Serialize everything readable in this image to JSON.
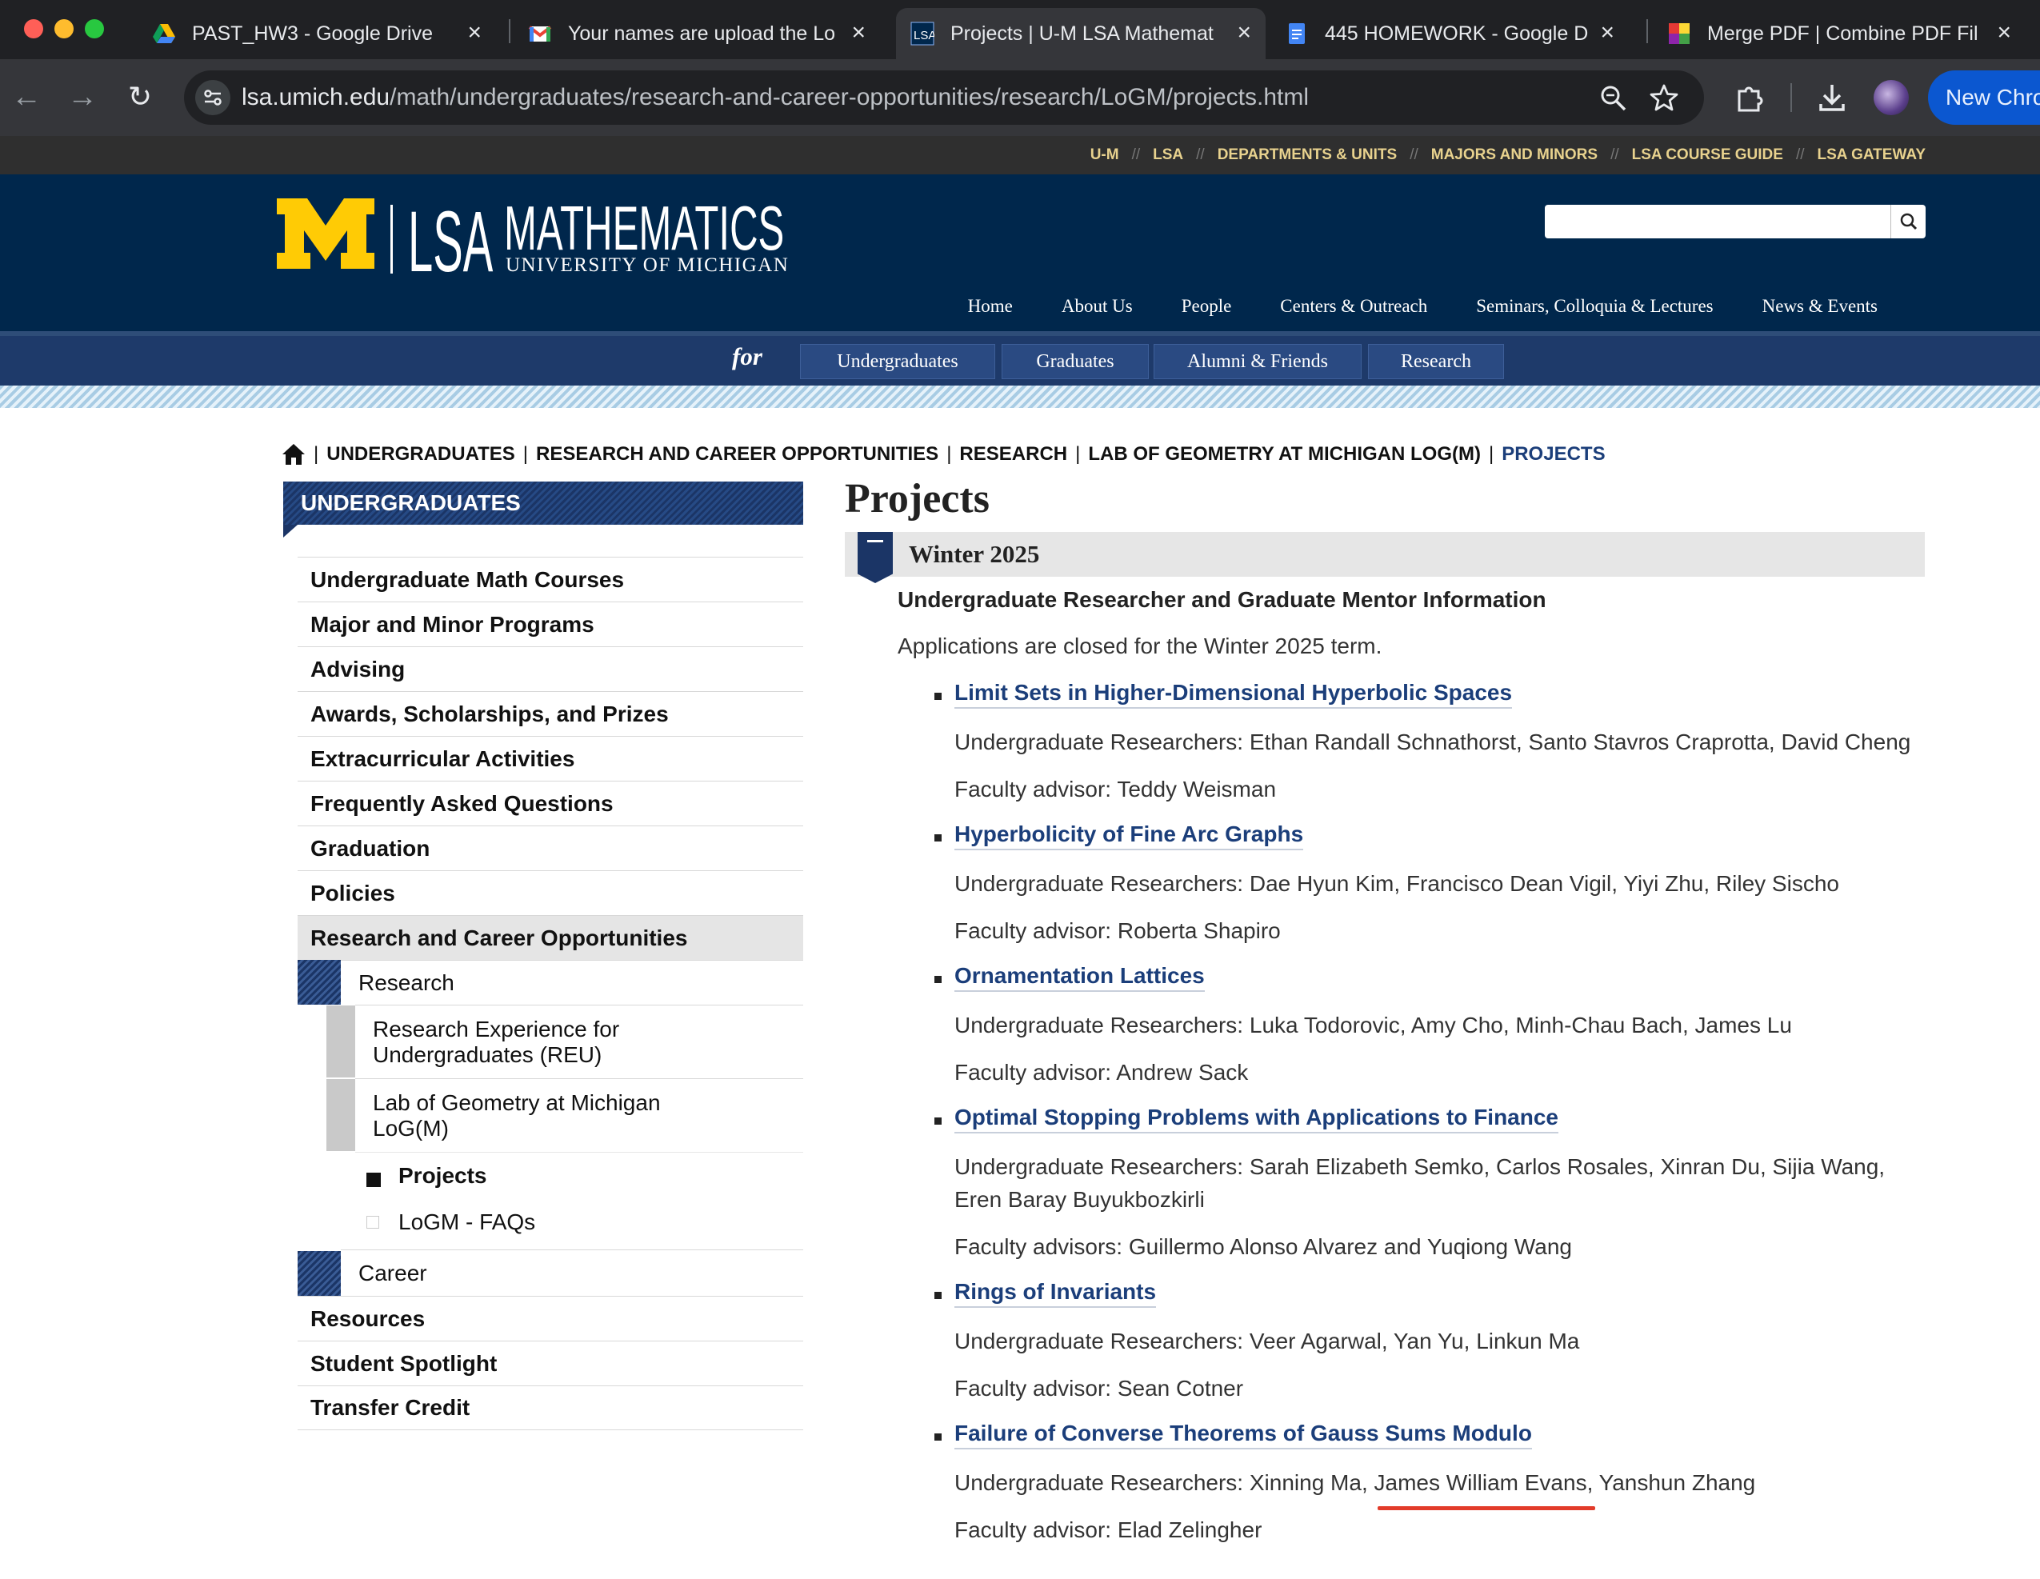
{
  "browser": {
    "tabs": [
      {
        "title": "PAST_HW3 - Google Drive",
        "icon": "google-drive-icon"
      },
      {
        "title": "Your names are upload the Lo",
        "icon": "gmail-icon"
      },
      {
        "title": "Projects | U-M LSA Mathemat",
        "icon": "lsa-favicon",
        "active": true
      },
      {
        "title": "445 HOMEWORK - Google Do",
        "icon": "google-docs-icon"
      },
      {
        "title": "Merge PDF | Combine PDF Fil",
        "icon": "ilovepdf-icon"
      }
    ],
    "url_host": "lsa.umich.edu",
    "url_path": "/math/undergraduates/research-and-career-opportunities/research/LoGM/projects.html",
    "new_chrome_label": "New Chro"
  },
  "utility_links": [
    "U-M",
    "LSA",
    "DEPARTMENTS & UNITS",
    "MAJORS AND MINORS",
    "LSA COURSE GUIDE",
    "LSA GATEWAY"
  ],
  "brand": {
    "lsa": "LSA",
    "department": "MATHEMATICS",
    "university": "UNIVERSITY OF MICHIGAN"
  },
  "main_nav": [
    "Home",
    "About Us",
    "People",
    "Centers & Outreach",
    "Seminars, Colloquia & Lectures",
    "News & Events"
  ],
  "audience": {
    "for_label": "for",
    "buttons": [
      "Undergraduates",
      "Graduates",
      "Alumni & Friends",
      "Research"
    ]
  },
  "breadcrumb": [
    "UNDERGRADUATES",
    "RESEARCH AND CAREER OPPORTUNITIES",
    "RESEARCH",
    "LAB OF GEOMETRY AT MICHIGAN LOG(M)",
    "PROJECTS"
  ],
  "sidebar": {
    "header": "UNDERGRADUATES",
    "items": [
      "Undergraduate Math Courses",
      "Major and Minor Programs",
      "Advising",
      "Awards, Scholarships, and Prizes",
      "Extracurricular Activities",
      "Frequently Asked Questions",
      "Graduation",
      "Policies",
      "Research and Career Opportunities"
    ],
    "research": "Research",
    "reu_line1": "Research Experience for",
    "reu_line2": "Undergraduates (REU)",
    "logm_line1": "Lab of Geometry at Michigan",
    "logm_line2": "LoG(M)",
    "projects": "Projects",
    "faqs": "LoGM - FAQs",
    "career": "Career",
    "after_items": [
      "Resources",
      "Student Spotlight",
      "Transfer Credit"
    ]
  },
  "content": {
    "page_title": "Projects",
    "term": "Winter 2025",
    "section_heading": "Undergraduate Researcher and Graduate Mentor Information",
    "intro": "Applications are closed for the Winter 2025 term.",
    "projects": [
      {
        "title": "Limit Sets in Higher-Dimensional Hyperbolic Spaces",
        "researchers": "Undergraduate Researchers: Ethan Randall Schnathorst, Santo Stavros Craprotta, David Cheng",
        "advisor": "Faculty advisor: Teddy Weisman"
      },
      {
        "title": "Hyperbolicity of Fine Arc Graphs",
        "researchers": "Undergraduate Researchers:  Dae Hyun Kim, Francisco Dean Vigil, Yiyi Zhu, Riley Sischo",
        "advisor": "Faculty advisor: Roberta Shapiro"
      },
      {
        "title": "Ornamentation Lattices",
        "researchers": "Undergraduate Researchers: Luka Todorovic, Amy Cho, Minh-Chau Bach, James Lu",
        "advisor": "Faculty advisor: Andrew Sack"
      },
      {
        "title": "Optimal Stopping Problems with Applications to Finance",
        "researchers": "Undergraduate Researchers: Sarah Elizabeth Semko, Carlos Rosales, Xinran Du, Sijia Wang, Eren Baray Buyukbozkirli",
        "advisor": "Faculty advisors: Guillermo Alonso Alvarez and Yuqiong Wang"
      },
      {
        "title": "Rings of Invariants",
        "researchers": "Undergraduate Researchers: Veer Agarwal, Yan Yu, Linkun Ma",
        "advisor": "Faculty advisor: Sean Cotner"
      },
      {
        "title": "Failure of Converse Theorems of Gauss Sums Modulo",
        "researchers": "Undergraduate Researchers:  Xinning Ma, James William Evans, Yanshun Zhang",
        "advisor": "Faculty advisor: Elad Zelingher"
      }
    ]
  },
  "colors": {
    "maize": "#ffcb05",
    "blue": "#00274c",
    "link": "#1b3e7a",
    "annotation": "#e23b2a"
  }
}
